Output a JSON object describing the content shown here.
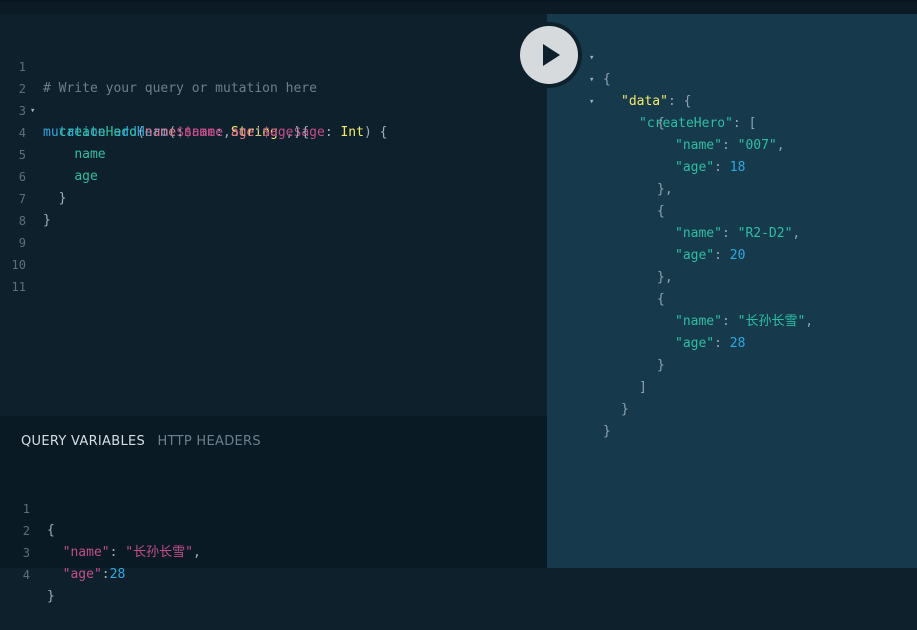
{
  "query_editor": {
    "lines": [
      {
        "num": "1",
        "fold": ""
      },
      {
        "num": "2",
        "fold": "▾"
      },
      {
        "num": "3",
        "fold": ""
      },
      {
        "num": "4",
        "fold": ""
      },
      {
        "num": "5",
        "fold": ""
      },
      {
        "num": "6",
        "fold": ""
      },
      {
        "num": "7",
        "fold": ""
      },
      {
        "num": "8",
        "fold": ""
      },
      {
        "num": "9",
        "fold": ""
      },
      {
        "num": "10",
        "fold": ""
      },
      {
        "num": "11",
        "fold": ""
      }
    ],
    "comment": "# Write your query or mutation here",
    "keyword": "mutation",
    "op_name": "addHero",
    "var_name": "$name",
    "type_string": "String",
    "var_age": "$age",
    "type_int": "Int",
    "field": "createHero",
    "arg_name": "name",
    "arg_name_val": "$name",
    "arg_age": "age",
    "arg_age_val": "$age",
    "sel_name": "name",
    "sel_age": "age"
  },
  "run_button": {
    "icon": "play-icon"
  },
  "variables_panel": {
    "tabs": [
      "QUERY VARIABLES",
      "HTTP HEADERS"
    ],
    "line_numbers": [
      "1",
      "2",
      "3",
      "4"
    ],
    "open_brace": "{",
    "name_key": "\"name\"",
    "name_value": "\"长孙长雪\"",
    "age_key": "\"age\"",
    "age_value": "28",
    "close_brace": "}"
  },
  "result": {
    "data_key": "\"data\"",
    "list_key": "\"createHero\"",
    "name_key": "\"name\"",
    "age_key": "\"age\"",
    "items": [
      {
        "name": "\"007\"",
        "age": "18"
      },
      {
        "name": "\"R2-D2\"",
        "age": "20"
      },
      {
        "name": "\"长孙长雪\"",
        "age": "28"
      }
    ]
  }
}
